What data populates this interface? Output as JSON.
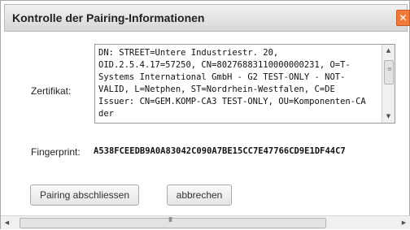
{
  "dialog": {
    "title": "Kontrolle der Pairing-Informationen",
    "close_icon": "x-icon"
  },
  "certificate": {
    "label": "Zertifikat:",
    "text": "DN: STREET=Untere Industriestr. 20, OID.2.5.4.17=57250, CN=80276883110000000231, O=T-Systems International GmbH - G2 TEST-ONLY - NOT-VALID, L=Netphen, ST=Nordrhein-Westfalen, C=DE Issuer: CN=GEM.KOMP-CA3 TEST-ONLY, OU=Komponenten-CA der"
  },
  "fingerprint": {
    "label": "Fingerprint:",
    "value": "A538FCEEDB9A0A83042C090A7BE15CC7E47766CD9E1DF44C7"
  },
  "buttons": {
    "confirm": "Pairing abschliessen",
    "cancel": "abbrechen"
  },
  "icons": {
    "scroll_up": "triangle-up-icon",
    "scroll_down": "triangle-down-icon",
    "scroll_left": "triangle-left-icon",
    "scroll_right": "triangle-right-icon",
    "grip": "grip-icon"
  }
}
